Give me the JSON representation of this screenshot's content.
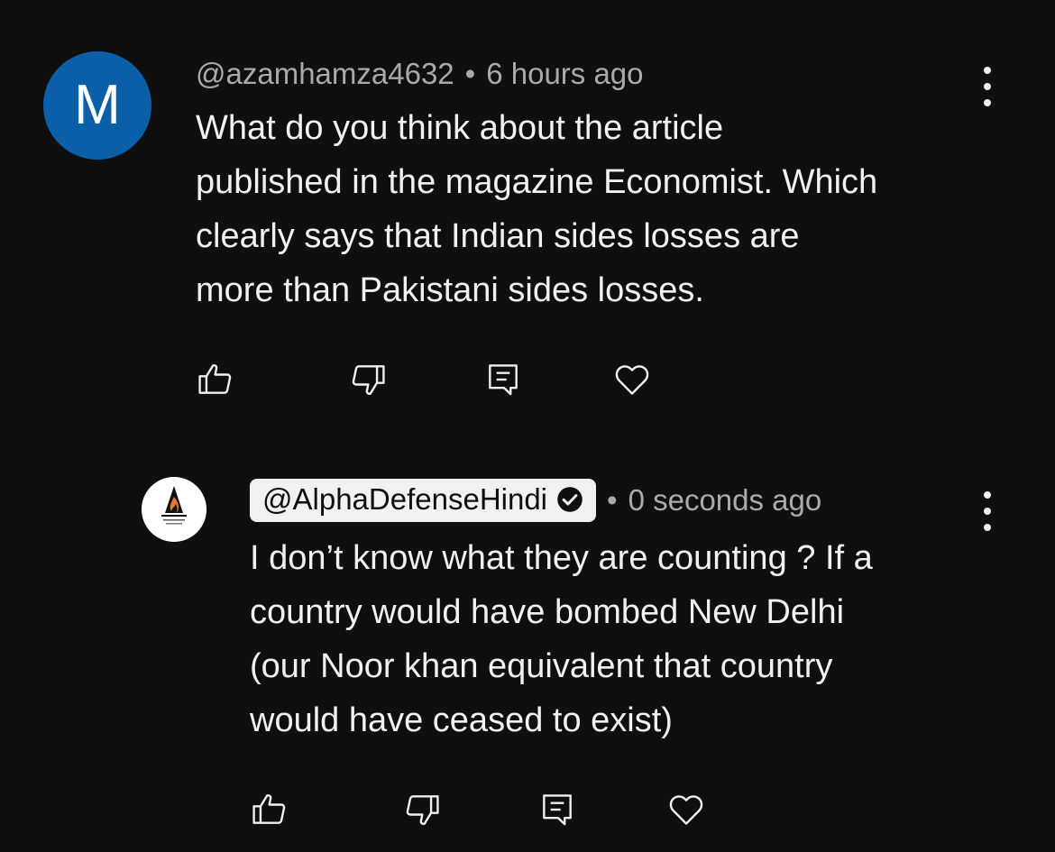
{
  "comments": [
    {
      "avatar_letter": "M",
      "avatar_color": "#0a5fa8",
      "handle": "@azamhamza4632",
      "separator": "•",
      "time": "6 hours ago",
      "lines": [
        "What do you think about the article",
        "published in the magazine Economist. Which",
        "clearly says that Indian sides losses are",
        "more than Pakistani sides losses."
      ],
      "actions": [
        "like-icon",
        "dislike-icon",
        "reply-icon",
        "heart-icon"
      ]
    },
    {
      "avatar_logo_text": "The Alpha Defense",
      "handle": "@AlphaDefenseHindi",
      "verified": true,
      "separator": "•",
      "time": "0 seconds ago",
      "lines": [
        "I don’t know what they are counting ? If a",
        "country would have bombed New Delhi",
        "(our Noor khan equivalent that country",
        "would have ceased to exist)"
      ],
      "actions": [
        "like-icon",
        "dislike-icon",
        "reply-icon",
        "heart-icon"
      ]
    }
  ],
  "colors": {
    "background": "#0f0f0f",
    "text": "#f1f1f1",
    "meta": "#aaaaaa"
  }
}
